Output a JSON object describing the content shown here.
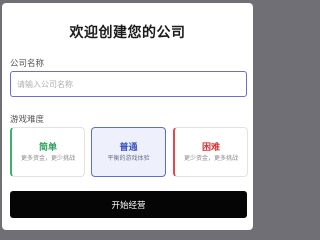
{
  "dialog": {
    "title": "欢迎创建您的公司",
    "company_name_label": "公司名称",
    "company_name_placeholder": "请输入公司名称",
    "company_name_value": "",
    "difficulty_label": "游戏难度",
    "selected_difficulty": "普通",
    "difficulties": [
      {
        "name": "简单",
        "desc": "更多资金，更少挑战",
        "color": "#2aa35a"
      },
      {
        "name": "普通",
        "desc": "平衡的游戏体验",
        "color": "#3f56c8"
      },
      {
        "name": "困难",
        "desc": "更少资金，更多挑战",
        "color": "#d23a3a"
      }
    ],
    "start_button_label": "开始经营"
  }
}
